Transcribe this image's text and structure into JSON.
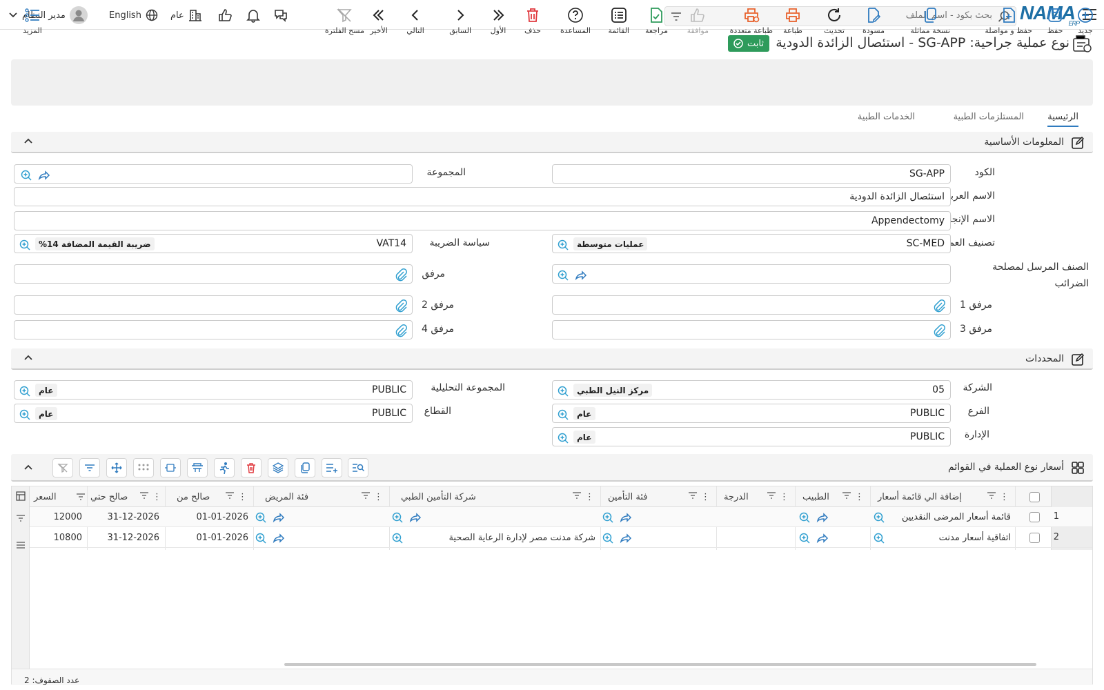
{
  "topbar": {
    "logo": "NAMA",
    "logo_sub": "ERP",
    "search_placeholder": "بحث بكود - اسم الملف",
    "user_name": "مدير النظام",
    "language": "English",
    "company": "عام"
  },
  "page": {
    "title": "نوع عملية جراحية: SG-APP - استئصال الزائدة الدودية",
    "status_badge": "ثابت"
  },
  "toolbar": {
    "new": "جديد",
    "save": "حفظ",
    "save_continue": "حفظ و مواصلة",
    "duplicate": "نسخة مماثلة",
    "draft": "مسودة",
    "refresh": "تحديث",
    "print": "طباعة",
    "multi_print": "طباعة متعددة",
    "approve": "موافقة",
    "review": "مراجعة",
    "list": "القائمة",
    "help": "المساعدة",
    "delete": "حذف",
    "first": "الأول",
    "previous": "السابق",
    "next": "التالي",
    "last": "الأخير",
    "clear_filter": "مسح الفلترة",
    "more": "المزيد"
  },
  "tabs": [
    "الرئيسية",
    "المستلزمات الطبية",
    "الخدمات الطبية"
  ],
  "basic_info": {
    "section_title": "المعلومات الأساسية",
    "code_label": "الكود",
    "code": "SG-APP",
    "group_label": "المجموعة",
    "group": "",
    "arabic_name_label": "الاسم العربي",
    "arabic_name": "استئصال الزائدة الدودية",
    "english_name_label": "الاسم الإنجليزي",
    "english_name": "Appendectomy",
    "classification_label": "تصنيف العملية",
    "classification_code": "SC-MED",
    "classification_name": "عمليات متوسطة",
    "tax_policy_label": "سياسة الضريبة",
    "tax_policy_code": "VAT14",
    "tax_policy_name": "ضريبة القيمة المضافة 14%",
    "tax_item_label": "الصنف المرسل لمصلحة الضرائب",
    "attachment_label": "مرفق",
    "attachment1_label": "مرفق 1",
    "attachment2_label": "مرفق 2",
    "attachment3_label": "مرفق 3",
    "attachment4_label": "مرفق 4"
  },
  "dimensions": {
    "section_title": "المحددات",
    "company_label": "الشركة",
    "company_code": "05",
    "company_name": "مركز النيل الطبي",
    "analysis_group_label": "المجموعة التحليلية",
    "analysis_group_code": "PUBLIC",
    "analysis_group_name": "عام",
    "branch_label": "الفرع",
    "branch_code": "PUBLIC",
    "branch_name": "عام",
    "sector_label": "القطاع",
    "sector_code": "PUBLIC",
    "sector_name": "عام",
    "department_label": "الإدارة",
    "department_code": "PUBLIC",
    "department_name": "عام"
  },
  "prices": {
    "section_title": "أسعار نوع العملية في القوائم",
    "columns": [
      "إضافة الي قائمة أسعار",
      "الطبيب",
      "الدرجة",
      "فئة التأمين",
      "شركة التأمين الطبي",
      "فئة المريض",
      "صالح من",
      "صالح حتي",
      "السعر"
    ],
    "rows": [
      {
        "n": "1",
        "price_list": "قائمة أسعار المرضى النقديين",
        "doctor": "",
        "grade": "",
        "insurance_class": "",
        "insurance_company": "",
        "patient_class": "",
        "valid_from": "01-01-2026",
        "valid_to": "31-12-2026",
        "price": "12000"
      },
      {
        "n": "2",
        "price_list": "اتفاقية أسعار مدنت",
        "doctor": "",
        "grade": "",
        "insurance_class": "",
        "insurance_company": "شركة مدنت مصر لإدارة الرعاية الصحية",
        "patient_class": "",
        "valid_from": "01-01-2026",
        "valid_to": "31-12-2026",
        "price": "10800"
      }
    ],
    "row_count_label": "عدد الصفوف: 2"
  }
}
